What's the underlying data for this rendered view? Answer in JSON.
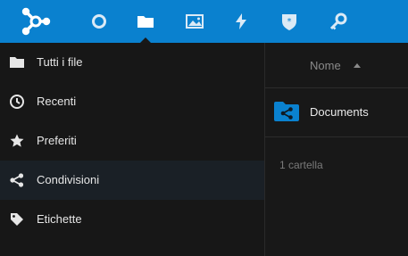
{
  "topbar": {
    "brand_color": "#0a81cf",
    "logo_icon": "share-network-logo-icon",
    "apps": [
      {
        "icon": "circle-icon",
        "active": false
      },
      {
        "icon": "folder-icon",
        "active": true
      },
      {
        "icon": "image-icon",
        "active": false
      },
      {
        "icon": "lightning-icon",
        "active": false
      },
      {
        "icon": "shield-star-icon",
        "active": false
      },
      {
        "icon": "key-icon",
        "active": false
      }
    ]
  },
  "sidebar": {
    "items": [
      {
        "label": "Tutti i file",
        "icon": "folder-icon",
        "active": false
      },
      {
        "label": "Recenti",
        "icon": "clock-icon",
        "active": false
      },
      {
        "label": "Preferiti",
        "icon": "star-icon",
        "active": false
      },
      {
        "label": "Condivisioni",
        "icon": "share-icon",
        "active": true
      },
      {
        "label": "Etichette",
        "icon": "tag-icon",
        "active": false
      }
    ]
  },
  "files": {
    "column_header": "Nome",
    "rows": [
      {
        "name": "Documents",
        "icon": "shared-folder-icon"
      }
    ],
    "summary": "1 cartella"
  }
}
